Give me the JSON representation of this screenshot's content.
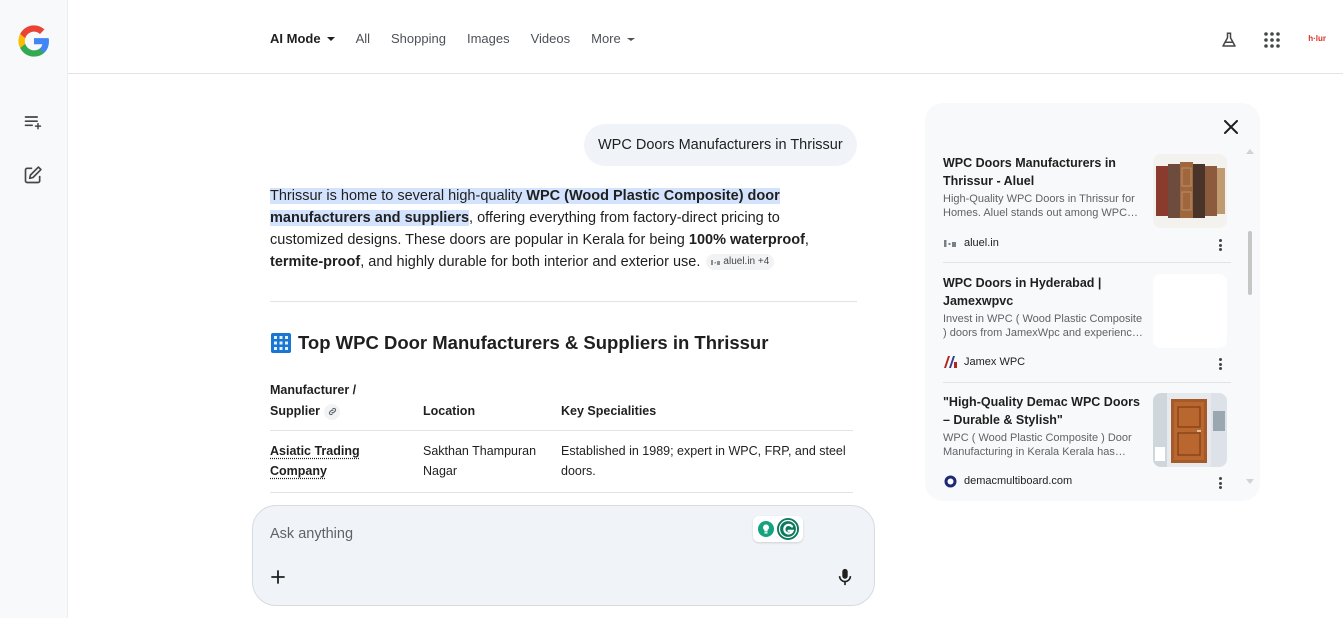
{
  "nav": {
    "tabs": [
      {
        "label": "AI Mode",
        "active": true,
        "dropdown": true
      },
      {
        "label": "All"
      },
      {
        "label": "Shopping"
      },
      {
        "label": "Images"
      },
      {
        "label": "Videos"
      },
      {
        "label": "More",
        "dropdown": true
      }
    ],
    "avatar_text": "h·lur"
  },
  "rail": {
    "icons": [
      "google-logo",
      "history-icon",
      "new-chat-icon"
    ]
  },
  "chat": {
    "user_query": "WPC Doors Manufacturers in Thrissur",
    "answer": {
      "hl1": "Thrissur is home to several high-quality ",
      "hl_bold": "WPC (Wood Plastic Composite) door manufacturers and suppliers",
      "rest1": ", offering everything from factory-direct pricing to customized designs. These doors are popular in Kerala for being ",
      "bold1": "100% waterproof",
      "rest2": ", ",
      "bold2": "termite-proof",
      "rest3": ", and highly durable for both interior and exterior use.",
      "source_chip": "aluel.in +4"
    },
    "section_title": "Top WPC Door Manufacturers & Suppliers in Thrissur",
    "table": {
      "headers": [
        "Manufacturer / Supplier",
        "Location",
        "Key Specialities"
      ],
      "rows": [
        [
          "Asiatic Trading Company",
          "Sakthan Thampuran Nagar",
          "Established in 1989; expert in WPC, FRP, and steel doors."
        ]
      ]
    }
  },
  "ask": {
    "placeholder": "Ask anything"
  },
  "panel": {
    "cards": [
      {
        "title": "WPC Doors Manufacturers in Thrissur - Aluel",
        "desc": "High-Quality WPC Doors in Thrissur for Homes. Aluel stands out among WPC manufacturers...",
        "source": "aluel.in"
      },
      {
        "title": "WPC Doors in Hyderabad | Jamexwpvc",
        "desc": "Invest in WPC ( Wood Plastic Composite ) doors from JamexWpc and experience unmatched...",
        "source": "Jamex WPC"
      },
      {
        "title": "\"High-Quality Demac WPC Doors – Durable & Stylish\"",
        "desc": "WPC ( Wood Plastic Composite ) Door Manufacturing in Kerala Kerala has grown...",
        "source": "demacmultiboard.com"
      }
    ]
  },
  "colors": {
    "highlight": "#d3e3fd",
    "accent": "#1a73e8",
    "panel_bg": "#f8f9fa"
  }
}
